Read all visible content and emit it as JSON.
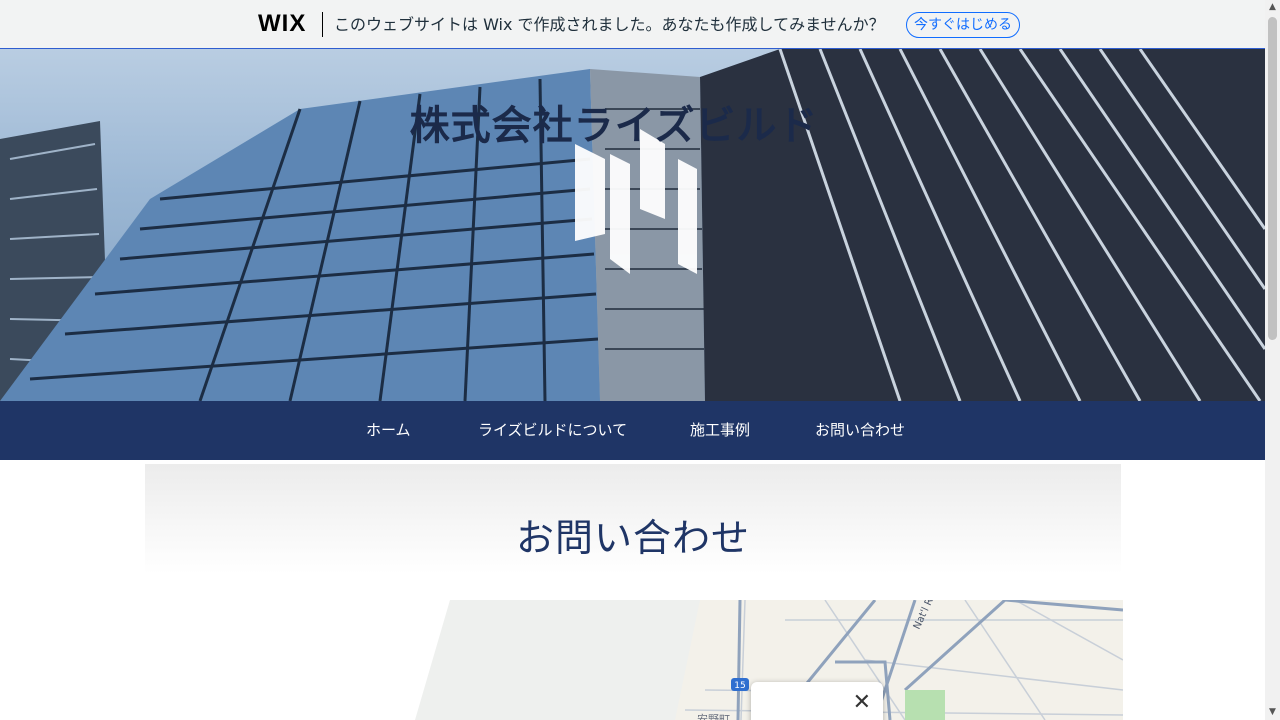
{
  "wix_banner": {
    "logo": "WIX",
    "message": "このウェブサイトは Wix で作成されました。あなたも作成してみませんか？",
    "cta": "今すぐはじめる"
  },
  "site": {
    "title": "株式会社ライズビルド"
  },
  "nav": {
    "items": [
      {
        "label": "ホーム"
      },
      {
        "label": "ライズビルドについて"
      },
      {
        "label": "施工事例"
      },
      {
        "label": "お問い合わせ"
      }
    ]
  },
  "contact": {
    "title": "お問い合わせ"
  },
  "map": {
    "route_shield": "15",
    "road_label": "Nat'l R",
    "place_fragment": "安野町",
    "close_icon": "close-icon"
  },
  "colors": {
    "nav_bg": "#1f3566",
    "accent": "#116dff",
    "title": "#1f3566"
  }
}
